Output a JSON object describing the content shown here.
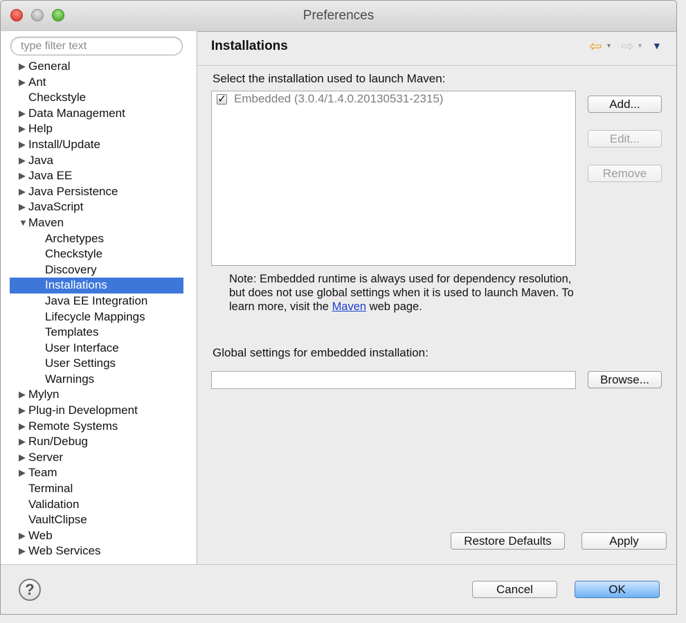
{
  "window": {
    "title": "Preferences"
  },
  "left_panel": {
    "filter_placeholder": "type filter text",
    "tree": [
      {
        "label": "General",
        "expandable": true,
        "level": 0
      },
      {
        "label": "Ant",
        "expandable": true,
        "level": 0
      },
      {
        "label": "Checkstyle",
        "expandable": false,
        "level": 0
      },
      {
        "label": "Data Management",
        "expandable": true,
        "level": 0
      },
      {
        "label": "Help",
        "expandable": true,
        "level": 0
      },
      {
        "label": "Install/Update",
        "expandable": true,
        "level": 0
      },
      {
        "label": "Java",
        "expandable": true,
        "level": 0
      },
      {
        "label": "Java EE",
        "expandable": true,
        "level": 0
      },
      {
        "label": "Java Persistence",
        "expandable": true,
        "level": 0
      },
      {
        "label": "JavaScript",
        "expandable": true,
        "level": 0
      },
      {
        "label": "Maven",
        "expandable": true,
        "expanded": true,
        "level": 0
      },
      {
        "label": "Archetypes",
        "level": 1
      },
      {
        "label": "Checkstyle",
        "level": 1
      },
      {
        "label": "Discovery",
        "level": 1
      },
      {
        "label": "Installations",
        "level": 1,
        "selected": true
      },
      {
        "label": "Java EE Integration",
        "level": 1
      },
      {
        "label": "Lifecycle Mappings",
        "level": 1
      },
      {
        "label": "Templates",
        "level": 1
      },
      {
        "label": "User Interface",
        "level": 1
      },
      {
        "label": "User Settings",
        "level": 1
      },
      {
        "label": "Warnings",
        "level": 1
      },
      {
        "label": "Mylyn",
        "expandable": true,
        "level": 0
      },
      {
        "label": "Plug-in Development",
        "expandable": true,
        "level": 0
      },
      {
        "label": "Remote Systems",
        "expandable": true,
        "level": 0
      },
      {
        "label": "Run/Debug",
        "expandable": true,
        "level": 0
      },
      {
        "label": "Server",
        "expandable": true,
        "level": 0
      },
      {
        "label": "Team",
        "expandable": true,
        "level": 0
      },
      {
        "label": "Terminal",
        "expandable": false,
        "level": 0
      },
      {
        "label": "Validation",
        "expandable": false,
        "level": 0
      },
      {
        "label": "VaultClipse",
        "expandable": false,
        "level": 0
      },
      {
        "label": "Web",
        "expandable": true,
        "level": 0
      },
      {
        "label": "Web Services",
        "expandable": true,
        "level": 0
      }
    ]
  },
  "page": {
    "title": "Installations",
    "select_label": "Select the installation used to launch Maven:",
    "installation_item": "Embedded (3.0.4/1.4.0.20130531-2315)",
    "installation_checked": true,
    "buttons": {
      "add": "Add...",
      "edit": "Edit...",
      "remove": "Remove",
      "browse": "Browse..."
    },
    "note_before_link": "Note: Embedded runtime is always used for dependency resolution, but does not use global settings when it is used to launch Maven. To learn more, visit the ",
    "note_link": "Maven",
    "note_after_link": " web page.",
    "global_settings_label": "Global settings for embedded installation:",
    "global_settings_value": "",
    "restore_defaults": "Restore Defaults",
    "apply": "Apply"
  },
  "footer": {
    "help_glyph": "?",
    "cancel": "Cancel",
    "ok": "OK"
  },
  "nav": {
    "back_icon": "back-arrow-icon",
    "forward_icon": "forward-arrow-icon",
    "menu_icon": "view-menu-icon"
  },
  "colors": {
    "selection": "#3d77d9",
    "link": "#1a3fcf",
    "ok_button": "#6fb1f4"
  }
}
